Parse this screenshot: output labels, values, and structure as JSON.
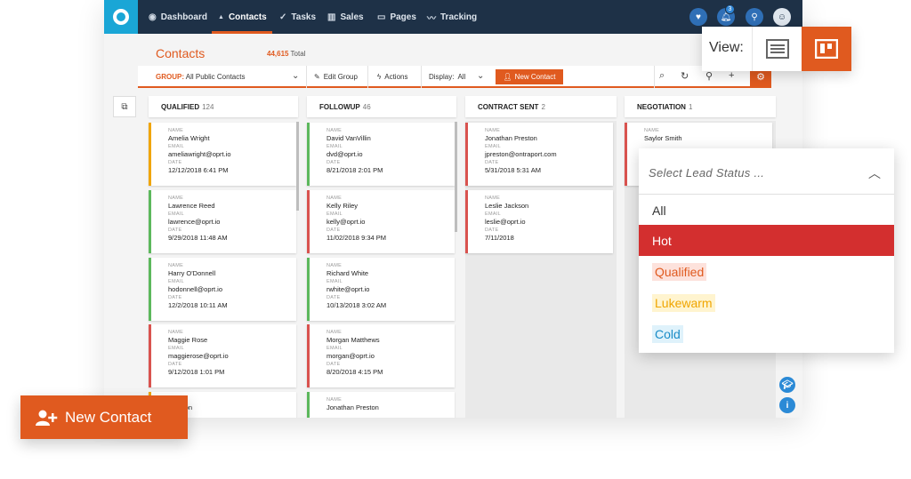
{
  "nav": {
    "items": [
      {
        "icon": "dashboard-icon",
        "glyph": "◉",
        "label": "Dashboard"
      },
      {
        "icon": "person-icon",
        "glyph": "▲",
        "label": "Contacts"
      },
      {
        "icon": "check-icon",
        "glyph": "✓",
        "label": "Tasks"
      },
      {
        "icon": "bar-chart-icon",
        "glyph": "▥",
        "label": "Sales"
      },
      {
        "icon": "pages-icon",
        "glyph": "▭",
        "label": "Pages"
      },
      {
        "icon": "tracking-icon",
        "glyph": "〰",
        "label": "Tracking"
      }
    ],
    "active": "Contacts",
    "notification_count": "3"
  },
  "page": {
    "title": "Contacts",
    "total_count": "44,615",
    "total_label": "Total"
  },
  "toolbar": {
    "group_label": "GROUP:",
    "group_value": "All Public Contacts",
    "edit_group": "Edit Group",
    "actions": "Actions",
    "display_label": "Display:",
    "display_value": "All",
    "new_contact": "New Contact"
  },
  "columns": [
    {
      "title": "QUALIFIED",
      "count": "124"
    },
    {
      "title": "FOLLOWUP",
      "count": "46"
    },
    {
      "title": "CONTRACT SENT",
      "count": "2"
    },
    {
      "title": "NEGOTIATION",
      "count": "1"
    }
  ],
  "field_labels": {
    "name": "NAME",
    "email": "EMAIL",
    "date": "DATE"
  },
  "cards": {
    "qualified": [
      {
        "name": "Amelia Wright",
        "email": "ameliawright@oprt.io",
        "date": "12/12/2018 6:41 PM",
        "color": "#f0a500"
      },
      {
        "name": "Lawrence Reed",
        "email": "lawrence@oprt.io",
        "date": "9/29/2018 11:48 AM",
        "color": "#5cb85c"
      },
      {
        "name": "Harry O'Donnell",
        "email": "hodonnell@oprt.io",
        "date": "12/2/2018 10:11 AM",
        "color": "#5cb85c"
      },
      {
        "name": "Maggie Rose",
        "email": "maggierose@oprt.io",
        "date": "9/12/2018 1:01 PM",
        "color": "#d9534f"
      },
      {
        "name": "Winston",
        "email": "",
        "date": "",
        "color": "#f0a500"
      }
    ],
    "followup": [
      {
        "name": "David VanVillin",
        "email": "dvd@oprt.io",
        "date": "8/21/2018 2:01 PM",
        "color": "#5cb85c"
      },
      {
        "name": "Kelly Riley",
        "email": "kelly@oprt.io",
        "date": "11/02/2018 9:34 PM",
        "color": "#d9534f"
      },
      {
        "name": "Richard White",
        "email": "rwhite@oprt.io",
        "date": "10/13/2018 3:02 AM",
        "color": "#5cb85c"
      },
      {
        "name": "Morgan Matthews",
        "email": "morgan@oprt.io",
        "date": "8/20/2018 4:15 PM",
        "color": "#d9534f"
      },
      {
        "name": "Jonathan Preston",
        "email": "",
        "date": "",
        "color": "#5cb85c"
      }
    ],
    "contract_sent": [
      {
        "name": "Jonathan Preston",
        "email": "jpreston@ontraport.com",
        "date": "5/31/2018 5:31 AM",
        "color": "#d9534f"
      },
      {
        "name": "Leslie Jackson",
        "email": "leslie@oprt.io",
        "date": "7/11/2018",
        "color": "#d9534f"
      }
    ],
    "negotiation": [
      {
        "name": "Saylor Smith",
        "email": "",
        "date": "",
        "color": "#d9534f"
      }
    ]
  },
  "view_switch": {
    "label": "View:"
  },
  "lead_status": {
    "placeholder": "Select Lead Status ...",
    "options": [
      {
        "label": "All"
      },
      {
        "label": "Hot",
        "selected": true
      },
      {
        "label": "Qualified",
        "color": "#e05a1f",
        "bg": "#fde2dc"
      },
      {
        "label": "Lukewarm",
        "color": "#f0a500",
        "bg": "#fff4cf"
      },
      {
        "label": "Cold",
        "color": "#1a8cc7",
        "bg": "#dff2fb"
      }
    ]
  },
  "floating_button": {
    "label": "New Contact"
  },
  "colors": {
    "accent": "#e05a1f",
    "nav_bg": "#1e3147",
    "logo": "#1aa6d6",
    "hot": "#d32f2f"
  }
}
